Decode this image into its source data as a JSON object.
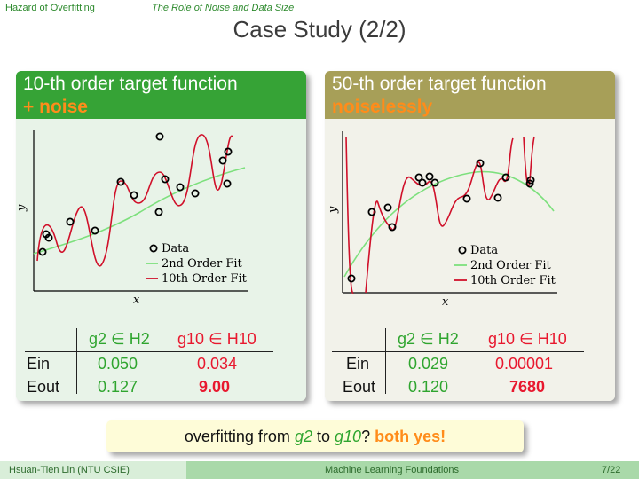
{
  "nav": {
    "left": "Hazard of Overfitting",
    "right": "The Role of Noise and Data Size"
  },
  "title": "Case Study (2/2)",
  "panels": [
    {
      "head1": "10-th order target function",
      "head2": "+ noise",
      "legend": [
        "Data",
        "2nd Order Fit",
        "10th Order Fit"
      ],
      "axes": {
        "x": "x",
        "y": "y"
      },
      "table": {
        "col1": "g2 ∈ H2",
        "col2": "g10 ∈ H10",
        "row1": "Ein",
        "row2": "Eout",
        "ein_g2": "0.050",
        "ein_g10": "0.034",
        "eout_g2": "0.127",
        "eout_g10": "9.00"
      }
    },
    {
      "head1": "50-th order target function",
      "head2": "noiselessly",
      "legend": [
        "Data",
        "2nd Order Fit",
        "10th Order Fit"
      ],
      "axes": {
        "x": "x",
        "y": "y"
      },
      "table": {
        "col1": "g2 ∈ H2",
        "col2": "g10 ∈ H10",
        "row1": "Ein",
        "row2": "Eout",
        "ein_g2": "0.029",
        "ein_g10": "0.00001",
        "eout_g2": "0.120",
        "eout_g10": "7680"
      }
    }
  ],
  "banner": {
    "pre": "overfitting from",
    "g2": "g2",
    "mid": "to",
    "g10": "g10",
    "q": "?",
    "answer": "both yes!"
  },
  "footer": {
    "author": "Hsuan-Tien Lin  (NTU CSIE)",
    "course": "Machine Learning Foundations",
    "page": "7/22"
  },
  "colors": {
    "green_fit": "#7de07d",
    "red_fit": "#d0102a",
    "header_left": "#36a336",
    "header_right": "#a79f58",
    "accent_orange": "#ff8c1a"
  }
}
